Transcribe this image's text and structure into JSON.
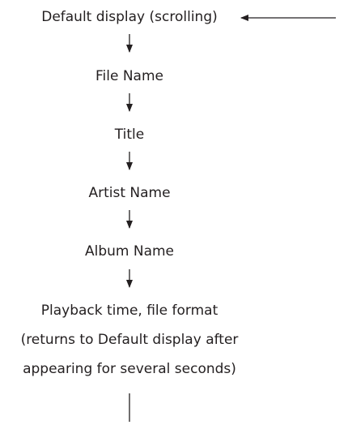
{
  "steps": [
    {
      "label": "Default display (scrolling)"
    },
    {
      "label": "File Name"
    },
    {
      "label": "Title"
    },
    {
      "label": "Artist Name"
    },
    {
      "label": "Album Name"
    },
    {
      "label": "Playback time, file format"
    }
  ],
  "note": {
    "line1": "(returns to Default display after",
    "line2": "appearing for several seconds)"
  },
  "colors": {
    "text": "#231f20",
    "line": "#231f20"
  }
}
